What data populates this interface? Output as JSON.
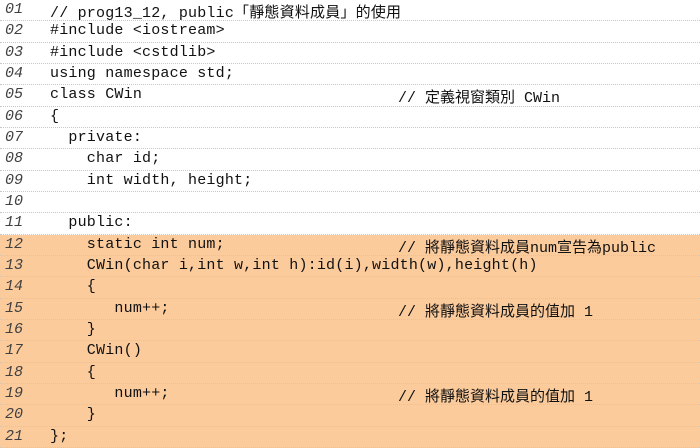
{
  "highlight_color": "#fbcb9c",
  "lines": [
    {
      "no": "01",
      "code": "// prog13_12, public「靜態資料成員」的使用",
      "comment": "",
      "highlight": false
    },
    {
      "no": "02",
      "code": "#include <iostream>",
      "comment": "",
      "highlight": false
    },
    {
      "no": "03",
      "code": "#include <cstdlib>",
      "comment": "",
      "highlight": false
    },
    {
      "no": "04",
      "code": "using namespace std;",
      "comment": "",
      "highlight": false
    },
    {
      "no": "05",
      "code": "class CWin",
      "comment": "// 定義視窗類別 CWin",
      "highlight": false
    },
    {
      "no": "06",
      "code": "{",
      "comment": "",
      "highlight": false
    },
    {
      "no": "07",
      "code": "  private:",
      "comment": "",
      "highlight": false
    },
    {
      "no": "08",
      "code": "    char id;",
      "comment": "",
      "highlight": false
    },
    {
      "no": "09",
      "code": "    int width, height;",
      "comment": "",
      "highlight": false
    },
    {
      "no": "10",
      "code": "",
      "comment": "",
      "highlight": false
    },
    {
      "no": "11",
      "code": "  public:",
      "comment": "",
      "highlight": false
    },
    {
      "no": "12",
      "code": "    static int num;",
      "comment": "// 將靜態資料成員num宣告為public",
      "highlight": true
    },
    {
      "no": "13",
      "code": "    CWin(char i,int w,int h):id(i),width(w),height(h)",
      "comment": "",
      "highlight": true
    },
    {
      "no": "14",
      "code": "    {",
      "comment": "",
      "highlight": true
    },
    {
      "no": "15",
      "code": "       num++;",
      "comment": "// 將靜態資料成員的值加 1",
      "highlight": true
    },
    {
      "no": "16",
      "code": "    }",
      "comment": "",
      "highlight": true
    },
    {
      "no": "17",
      "code": "    CWin()",
      "comment": "",
      "highlight": true
    },
    {
      "no": "18",
      "code": "    {",
      "comment": "",
      "highlight": true
    },
    {
      "no": "19",
      "code": "       num++;",
      "comment": "// 將靜態資料成員的值加 1",
      "highlight": true
    },
    {
      "no": "20",
      "code": "    }",
      "comment": "",
      "highlight": true
    },
    {
      "no": "21",
      "code": "};",
      "comment": "",
      "highlight": true
    }
  ]
}
